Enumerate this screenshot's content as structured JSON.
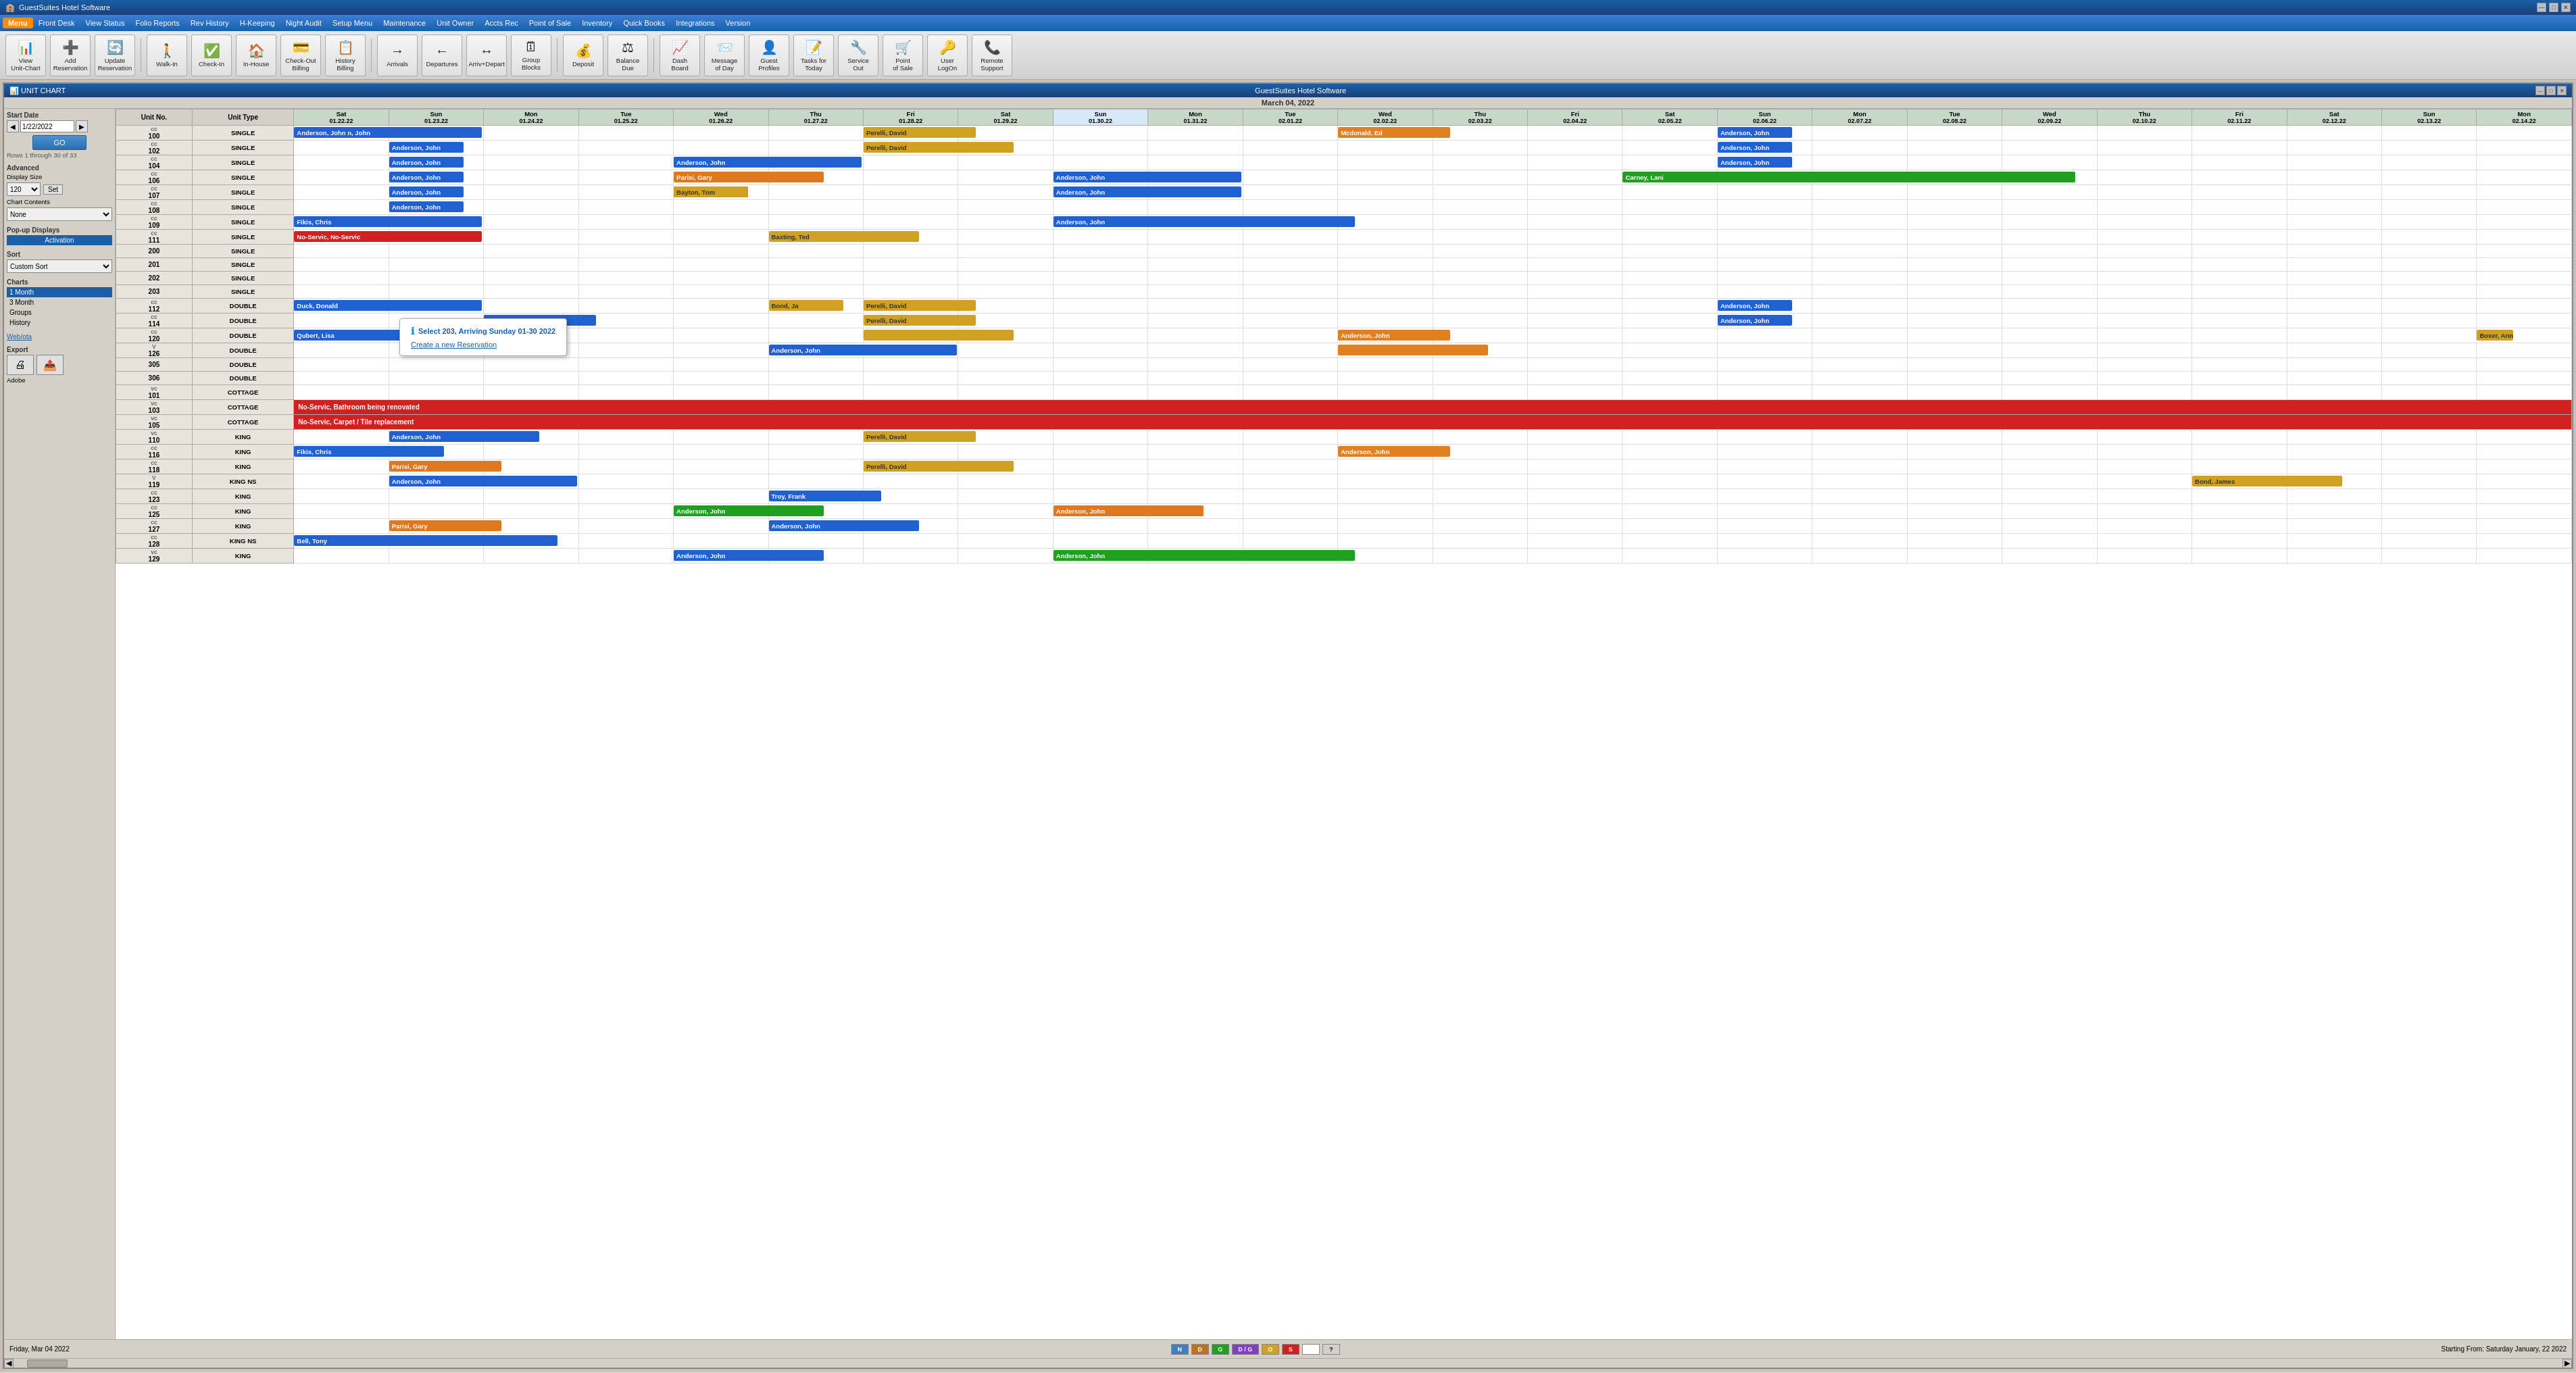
{
  "titleBar": {
    "title": "GuestSuites Hotel Software",
    "controls": [
      "—",
      "□",
      "✕"
    ]
  },
  "menuBar": {
    "items": [
      "Menu",
      "Front Desk",
      "View Status",
      "Folio Reports",
      "Rev History",
      "H-Keeping",
      "Night Audit",
      "Setup Menu",
      "Maintenance",
      "Unit Owner",
      "Accts Rec",
      "Point of Sale",
      "Inventory",
      "Quick Books",
      "Integrations",
      "Version"
    ]
  },
  "toolbar": {
    "buttons": [
      {
        "id": "view-unit-chart",
        "icon": "📊",
        "label": "View\nUnit-Chart"
      },
      {
        "id": "add-reservation",
        "icon": "➕",
        "label": "Add\nReservation"
      },
      {
        "id": "update-reservation",
        "icon": "🔄",
        "label": "Update\nReservation"
      },
      {
        "id": "walk-in",
        "icon": "🚶",
        "label": "Walk-In"
      },
      {
        "id": "check-in",
        "icon": "✅",
        "label": "Check-In"
      },
      {
        "id": "in-house",
        "icon": "🏠",
        "label": "In-House"
      },
      {
        "id": "check-out-billing",
        "icon": "💳",
        "label": "Check-Out\nBilling"
      },
      {
        "id": "history-billing",
        "icon": "📋",
        "label": "History\nBilling"
      },
      {
        "id": "arrivals",
        "icon": "→",
        "label": "Arrivals"
      },
      {
        "id": "departures",
        "icon": "←",
        "label": "Departures"
      },
      {
        "id": "arriv-depart",
        "icon": "↔",
        "label": "Arriv+Depart"
      },
      {
        "id": "group-blocks",
        "icon": "🗓",
        "label": "Group\nBlocks"
      },
      {
        "id": "deposit",
        "icon": "💰",
        "label": "Deposit"
      },
      {
        "id": "balance-due",
        "icon": "⚖",
        "label": "Balance\nDue"
      },
      {
        "id": "dash-board",
        "icon": "📈",
        "label": "Dash\nBoard"
      },
      {
        "id": "message-of-day",
        "icon": "📨",
        "label": "Message\nof Day"
      },
      {
        "id": "guest-profiles",
        "icon": "👤",
        "label": "Guest\nProfiles"
      },
      {
        "id": "tasks-for-today",
        "icon": "📝",
        "label": "Tasks for\nToday"
      },
      {
        "id": "service-out",
        "icon": "🔧",
        "label": "Service\nOut"
      },
      {
        "id": "point-of-sale",
        "icon": "🛒",
        "label": "Point\nof Sale"
      },
      {
        "id": "user-logon",
        "icon": "🔑",
        "label": "User\nLogOn"
      },
      {
        "id": "remote-support",
        "icon": "📞",
        "label": "Remote\nSupport"
      }
    ]
  },
  "innerWindow": {
    "title": "UNIT CHART",
    "subtitle": "GuestSuites Hotel Software",
    "chartDate": "March 04, 2022"
  },
  "sidebar": {
    "startDate": {
      "label": "Start Date",
      "value": "1/22/2022"
    },
    "rowsInfo": "Rows 1 through 30 of 33",
    "advanced": {
      "label": "Advanced",
      "displaySize": {
        "label": "Display Size",
        "value": "120"
      },
      "chartContents": {
        "label": "Chart Contents",
        "value": "None"
      }
    },
    "popupDisplays": {
      "label": "Pop-up Displays",
      "activation": "Activation"
    },
    "sort": {
      "label": "Sort",
      "value": "Custom Sort"
    },
    "charts": {
      "label": "Charts",
      "items": [
        "1 Month",
        "3 Month",
        "Groups",
        "History"
      ]
    },
    "webOta": "Web/ota",
    "export": {
      "label": "Export",
      "adobe": "Adobe"
    }
  },
  "dateHeaders": [
    {
      "day": "Sat",
      "date": "01.22.22"
    },
    {
      "day": "Sun",
      "date": "01.23.22"
    },
    {
      "day": "Mon",
      "date": "01.24.22"
    },
    {
      "day": "Tue",
      "date": "01.25.22"
    },
    {
      "day": "Wed",
      "date": "01.26.22"
    },
    {
      "day": "Thu",
      "date": "01.27.22"
    },
    {
      "day": "Fri",
      "date": "01.28.22"
    },
    {
      "day": "Sat",
      "date": "01.29.22"
    },
    {
      "day": "Sun",
      "date": "01.30.22"
    },
    {
      "day": "Mon",
      "date": "01.31.22"
    },
    {
      "day": "Tue",
      "date": "02.01.22"
    },
    {
      "day": "Wed",
      "date": "02.02.22"
    },
    {
      "day": "Thu",
      "date": "02.03.22"
    },
    {
      "day": "Fri",
      "date": "02.04.22"
    },
    {
      "day": "Sat",
      "date": "02.05.22"
    },
    {
      "day": "Sun",
      "date": "02.06.22"
    },
    {
      "day": "Mon",
      "date": "02.07.22"
    },
    {
      "day": "Tue",
      "date": "02.08.22"
    },
    {
      "day": "Wed",
      "date": "02.09.22"
    },
    {
      "day": "Thu",
      "date": "02.10.22"
    },
    {
      "day": "Fri",
      "date": "02.11.22"
    },
    {
      "day": "Sat",
      "date": "02.12.22"
    },
    {
      "day": "Sun",
      "date": "02.13.22"
    },
    {
      "day": "Mon",
      "date": "02.14.22"
    }
  ],
  "units": [
    {
      "prefix": "cc",
      "no": "100",
      "type": "SINGLE"
    },
    {
      "prefix": "cc",
      "no": "102",
      "type": "SINGLE"
    },
    {
      "prefix": "cc",
      "no": "104",
      "type": "SINGLE"
    },
    {
      "prefix": "cc",
      "no": "106",
      "type": "SINGLE"
    },
    {
      "prefix": "cc",
      "no": "107",
      "type": "SINGLE"
    },
    {
      "prefix": "cc",
      "no": "108",
      "type": "SINGLE"
    },
    {
      "prefix": "cc",
      "no": "109",
      "type": "SINGLE"
    },
    {
      "prefix": "cc",
      "no": "111",
      "type": "SINGLE"
    },
    {
      "prefix": "",
      "no": "200",
      "type": "SINGLE"
    },
    {
      "prefix": "",
      "no": "201",
      "type": "SINGLE"
    },
    {
      "prefix": "",
      "no": "202",
      "type": "SINGLE"
    },
    {
      "prefix": "",
      "no": "203",
      "type": "SINGLE"
    },
    {
      "prefix": "cc",
      "no": "112",
      "type": "DOUBLE"
    },
    {
      "prefix": "cc",
      "no": "114",
      "type": "DOUBLE"
    },
    {
      "prefix": "cc",
      "no": "120",
      "type": "DOUBLE"
    },
    {
      "prefix": "V",
      "no": "126",
      "type": "DOUBLE"
    },
    {
      "prefix": "",
      "no": "305",
      "type": "DOUBLE"
    },
    {
      "prefix": "",
      "no": "306",
      "type": "DOUBLE"
    },
    {
      "prefix": "vc",
      "no": "101",
      "type": "COTTAGE"
    },
    {
      "prefix": "vc",
      "no": "103",
      "type": "COTTAGE"
    },
    {
      "prefix": "vc",
      "no": "105",
      "type": "COTTAGE"
    },
    {
      "prefix": "vc",
      "no": "110",
      "type": "KING"
    },
    {
      "prefix": "cc",
      "no": "116",
      "type": "KING"
    },
    {
      "prefix": "cc",
      "no": "118",
      "type": "KING"
    },
    {
      "prefix": "V",
      "no": "119",
      "type": "KING NS"
    },
    {
      "prefix": "cc",
      "no": "123",
      "type": "KING"
    },
    {
      "prefix": "cc",
      "no": "125",
      "type": "KING"
    },
    {
      "prefix": "cc",
      "no": "127",
      "type": "KING"
    },
    {
      "prefix": "cc",
      "no": "128",
      "type": "KING NS"
    },
    {
      "prefix": "vc",
      "no": "129",
      "type": "KING"
    }
  ],
  "popup": {
    "title": "Select 203, Arriving Sunday 01-30 2022",
    "action": "Create a new Reservation"
  },
  "bottomBar": {
    "date": "Friday, Mar 04 2022",
    "startingFrom": "Starting From: Saturday January, 22 2022",
    "legend": [
      {
        "key": "N",
        "class": "leg-n"
      },
      {
        "key": "D",
        "class": "leg-d"
      },
      {
        "key": "G",
        "class": "leg-g"
      },
      {
        "key": "D / G",
        "class": "leg-dg"
      },
      {
        "key": "O",
        "class": "leg-o"
      },
      {
        "key": "S",
        "class": "leg-s"
      },
      {
        "key": "",
        "class": "leg-empty"
      },
      {
        "key": "?",
        "class": "leg-q"
      }
    ]
  }
}
